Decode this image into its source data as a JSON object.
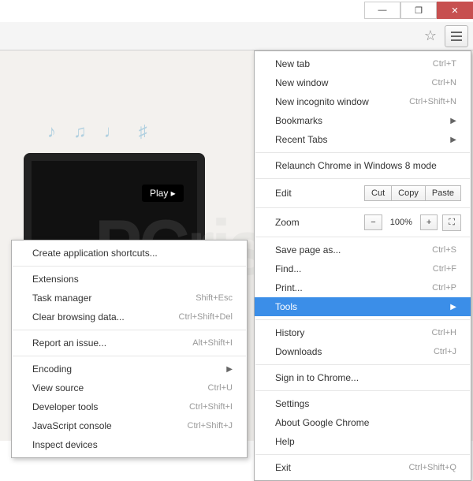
{
  "window": {
    "minimize": "—",
    "maximize": "❐",
    "close": "✕"
  },
  "background": {
    "play": "Play ▸",
    "notes": "♪ ♫ ♩ ♯",
    "watermark": "PCrisk.com"
  },
  "menu": {
    "new_tab": {
      "label": "New tab",
      "shortcut": "Ctrl+T"
    },
    "new_window": {
      "label": "New window",
      "shortcut": "Ctrl+N"
    },
    "new_incognito": {
      "label": "New incognito window",
      "shortcut": "Ctrl+Shift+N"
    },
    "bookmarks": {
      "label": "Bookmarks"
    },
    "recent_tabs": {
      "label": "Recent Tabs"
    },
    "relaunch": {
      "label": "Relaunch Chrome in Windows 8 mode"
    },
    "edit": {
      "label": "Edit",
      "cut": "Cut",
      "copy": "Copy",
      "paste": "Paste"
    },
    "zoom": {
      "label": "Zoom",
      "minus": "−",
      "pct": "100%",
      "plus": "+",
      "full": "⛶"
    },
    "save": {
      "label": "Save page as...",
      "shortcut": "Ctrl+S"
    },
    "find": {
      "label": "Find...",
      "shortcut": "Ctrl+F"
    },
    "print": {
      "label": "Print...",
      "shortcut": "Ctrl+P"
    },
    "tools": {
      "label": "Tools"
    },
    "history": {
      "label": "History",
      "shortcut": "Ctrl+H"
    },
    "downloads": {
      "label": "Downloads",
      "shortcut": "Ctrl+J"
    },
    "signin": {
      "label": "Sign in to Chrome..."
    },
    "settings": {
      "label": "Settings"
    },
    "about": {
      "label": "About Google Chrome"
    },
    "help": {
      "label": "Help"
    },
    "exit": {
      "label": "Exit",
      "shortcut": "Ctrl+Shift+Q"
    }
  },
  "submenu": {
    "shortcuts": {
      "label": "Create application shortcuts..."
    },
    "extensions": {
      "label": "Extensions"
    },
    "taskmgr": {
      "label": "Task manager",
      "shortcut": "Shift+Esc"
    },
    "clear": {
      "label": "Clear browsing data...",
      "shortcut": "Ctrl+Shift+Del"
    },
    "report": {
      "label": "Report an issue...",
      "shortcut": "Alt+Shift+I"
    },
    "encoding": {
      "label": "Encoding"
    },
    "view_source": {
      "label": "View source",
      "shortcut": "Ctrl+U"
    },
    "devtools": {
      "label": "Developer tools",
      "shortcut": "Ctrl+Shift+I"
    },
    "jsconsole": {
      "label": "JavaScript console",
      "shortcut": "Ctrl+Shift+J"
    },
    "inspect": {
      "label": "Inspect devices"
    }
  }
}
